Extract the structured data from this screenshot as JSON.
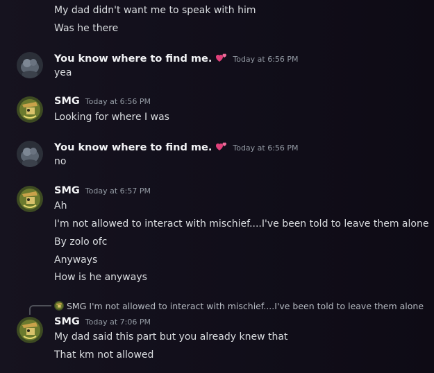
{
  "messages": [
    {
      "lines": [
        "My dad didn't want me to speak with him",
        "Was he there"
      ]
    },
    {
      "username": "You know where to find me.",
      "emoji": "two-hearts",
      "timestamp": "Today at 6:56 PM",
      "lines": [
        "yea"
      ]
    },
    {
      "username": "SMG",
      "timestamp": "Today at 6:56 PM",
      "lines": [
        "Looking for where I was"
      ]
    },
    {
      "username": "You know where to find me.",
      "emoji": "two-hearts",
      "timestamp": "Today at 6:56 PM",
      "lines": [
        "no"
      ]
    },
    {
      "username": "SMG",
      "timestamp": "Today at 6:57 PM",
      "lines": [
        "Ah",
        "I'm not allowed to interact with mischief....I've been told to leave them alone",
        "By zolo ofc",
        "Anyways",
        "How is he anyways"
      ]
    },
    {
      "username": "SMG",
      "timestamp": "Today at 7:06 PM",
      "lines": [
        "My dad said this part but you already knew that",
        "That km not allowed"
      ]
    }
  ],
  "reply": {
    "username": "SMG",
    "text": "I'm not allowed to interact with mischief....I've been told to leave them alone"
  },
  "colors": {
    "background": "#120f1b",
    "username": "#f2f3f5",
    "message_text": "#dbdee1",
    "timestamp": "#949ba4",
    "heart": "#e0407a"
  }
}
